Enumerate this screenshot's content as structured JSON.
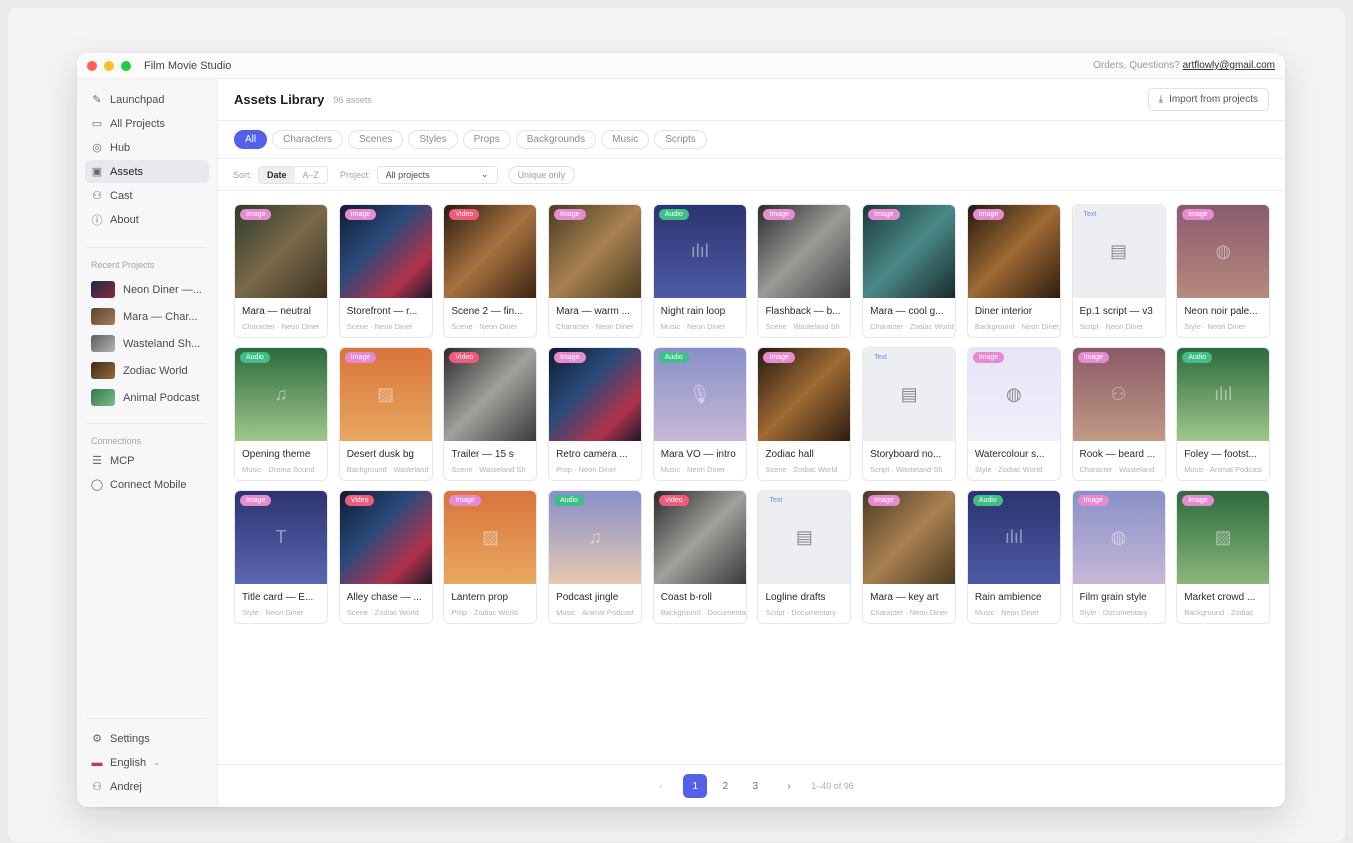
{
  "window": {
    "title": "Film Movie Studio",
    "contact_prefix": "Orders, Questions?",
    "contact_email": "artflowly@gmail.com",
    "traffic_colors": [
      "#ff5f57",
      "#febc2e",
      "#28c840"
    ]
  },
  "sidebar": {
    "nav": [
      {
        "label": "Launchpad",
        "icon": "rocket-icon",
        "glyph": "✎"
      },
      {
        "label": "All Projects",
        "icon": "folder-icon",
        "glyph": "▭"
      },
      {
        "label": "Hub",
        "icon": "compass-icon",
        "glyph": "◎"
      },
      {
        "label": "Assets",
        "icon": "bookmark-icon",
        "glyph": "▣"
      },
      {
        "label": "Cast",
        "icon": "users-icon",
        "glyph": "⚇"
      },
      {
        "label": "About",
        "icon": "info-icon",
        "glyph": "ⓘ"
      }
    ],
    "active_index": 3,
    "recent_label": "Recent Projects",
    "recent": [
      {
        "label": "Neon Diner —...",
        "color": "linear-gradient(135deg,#1c2a48,#8a2a3a)"
      },
      {
        "label": "Mara — Char...",
        "color": "linear-gradient(135deg,#5a4632,#a77c55)"
      },
      {
        "label": "Wasteland Sh...",
        "color": "linear-gradient(135deg,#5c5c5c,#b5b5b0)"
      },
      {
        "label": "Zodiac World",
        "color": "linear-gradient(135deg,#3a2a1c,#9a6a3c)"
      },
      {
        "label": "Animal Podcast",
        "color": "linear-gradient(135deg,#2f7a4a,#7fbb8a)"
      }
    ],
    "connections_label": "Connections",
    "connections": [
      {
        "label": "MCP",
        "icon": "server-icon",
        "glyph": "☰"
      },
      {
        "label": "Connect Mobile",
        "icon": "chat-icon",
        "glyph": "◯"
      }
    ],
    "settings": "Settings",
    "language": "English",
    "user": "Andrej"
  },
  "header": {
    "title": "Assets Library",
    "count": "96 assets",
    "import_label": "Import from projects"
  },
  "tabs": [
    "All",
    "Characters",
    "Scenes",
    "Styles",
    "Props",
    "Backgrounds",
    "Music",
    "Scripts"
  ],
  "filters": {
    "sort_label": "Sort:",
    "sort_options": [
      "Date",
      "A–Z"
    ],
    "project_label": "Project:",
    "project_value": "All projects",
    "unique_label": "Unique only"
  },
  "badge_colors": {
    "Image": "#e58bd0",
    "Video": "#ef5b7b",
    "Audio": "#3fbf87",
    "Text": "#9bb8ef"
  },
  "assets": [
    {
      "title": "Mara — neutral",
      "sub": "Character · Neon Diner",
      "type": "Image",
      "bg": "linear-gradient(135deg,#2e3b2a,#7a6a4a 50%,#3c3020)",
      "glyph": ""
    },
    {
      "title": "Storefront — r...",
      "sub": "Scene · Neon Diner",
      "type": "Image",
      "bg": "linear-gradient(135deg,#0e1a30,#2a4a7a 40%,#b0324a 75%,#1a1a2a)",
      "glyph": ""
    },
    {
      "title": "Scene 2 — fin...",
      "sub": "Scene · Neon Diner",
      "type": "Video",
      "bg": "linear-gradient(135deg,#2a1a10,#a87240 50%,#3a2414)",
      "glyph": ""
    },
    {
      "title": "Mara — warm ...",
      "sub": "Character · Neon Diner",
      "type": "Image",
      "bg": "linear-gradient(135deg,#4a3a24,#a88050 50%,#4a3a20)",
      "glyph": ""
    },
    {
      "title": "Night rain loop",
      "sub": "Music · Neon Diner",
      "type": "Audio",
      "bg": "linear-gradient(180deg,#2c3470,#4d5aa5)",
      "glyph": "ılıl"
    },
    {
      "title": "Flashback — b...",
      "sub": "Scene · Wasteland Sh",
      "type": "Image",
      "bg": "linear-gradient(135deg,#2a2a2a,#9a9a96 50%,#444)",
      "glyph": ""
    },
    {
      "title": "Mara — cool g...",
      "sub": "Character · Zodiac World",
      "type": "Image",
      "bg": "linear-gradient(135deg,#1a3a3a,#4a8a88 50%,#1a2a2a)",
      "glyph": ""
    },
    {
      "title": "Diner interior",
      "sub": "Background · Neon Diner",
      "type": "Image",
      "bg": "linear-gradient(135deg,#241810,#a06a34 50%,#2c1c10)",
      "glyph": ""
    },
    {
      "title": "Ep.1 script — v3",
      "sub": "Script · Neon Diner",
      "type": "Text",
      "bg": "#eceef2",
      "glyph": "▤"
    },
    {
      "title": "Neon noir pale...",
      "sub": "Style · Neon Diner",
      "type": "Image",
      "bg": "linear-gradient(180deg,#8a5a70,#b68a7c)",
      "glyph": "◍"
    },
    {
      "title": "Opening theme",
      "sub": "Music · Drama Sound",
      "type": "Audio",
      "bg": "linear-gradient(180deg,#2e6a3e,#9ec88a)",
      "glyph": "♫"
    },
    {
      "title": "Desert dusk bg",
      "sub": "Background · Wasteland",
      "type": "Image",
      "bg": "linear-gradient(180deg,#d9743c,#e8a860)",
      "glyph": "▨"
    },
    {
      "title": "Trailer — 15 s",
      "sub": "Scene · Wasteland Sh",
      "type": "Video",
      "bg": "linear-gradient(135deg,#2a2a2a,#a0a09c 50%,#3a3a3a)",
      "glyph": ""
    },
    {
      "title": "Retro camera ...",
      "sub": "Prop · Neon Diner",
      "type": "Image",
      "bg": "linear-gradient(135deg,#0e1a30,#2a4a7a 40%,#b0324a 75%,#1a1a2a)",
      "glyph": ""
    },
    {
      "title": "Mara VO — intro",
      "sub": "Music · Neon Diner",
      "type": "Audio",
      "bg": "linear-gradient(180deg,#8890c8,#c8b8d8)",
      "glyph": "🎙"
    },
    {
      "title": "Zodiac hall",
      "sub": "Scene · Zodiac World",
      "type": "Image",
      "bg": "linear-gradient(135deg,#241810,#a06a34 50%,#2c1c10)",
      "glyph": ""
    },
    {
      "title": "Storyboard no...",
      "sub": "Script · Wasteland Sh",
      "type": "Text",
      "bg": "#eceef2",
      "glyph": "▤"
    },
    {
      "title": "Watercolour s...",
      "sub": "Style · Zodiac World",
      "type": "Image",
      "bg": "linear-gradient(180deg,#e8e4f8,#f2eefa)",
      "glyph": "◍"
    },
    {
      "title": "Rook — beard ...",
      "sub": "Character · Wasteland",
      "type": "Image",
      "bg": "linear-gradient(180deg,#8a5a68,#c29a84)",
      "glyph": "⚇"
    },
    {
      "title": "Foley — footst...",
      "sub": "Music · Animal Podcast",
      "type": "Audio",
      "bg": "linear-gradient(180deg,#2e6a3e,#9ec88a)",
      "glyph": "ılıl"
    },
    {
      "title": "Title card — E...",
      "sub": "Style · Neon Diner",
      "type": "Image",
      "bg": "linear-gradient(180deg,#2c3470,#5a66b0)",
      "glyph": "T"
    },
    {
      "title": "Alley chase — ...",
      "sub": "Scene · Zodiac World",
      "type": "Video",
      "bg": "linear-gradient(135deg,#0e1a30,#2a4a7a 40%,#b0324a 75%,#1a1a2a)",
      "glyph": ""
    },
    {
      "title": "Lantern prop",
      "sub": "Prop · Zodiac World",
      "type": "Image",
      "bg": "linear-gradient(180deg,#d9743c,#e8a860)",
      "glyph": "▨"
    },
    {
      "title": "Podcast jingle",
      "sub": "Music · Animal Podcast",
      "type": "Audio",
      "bg": "linear-gradient(180deg,#8890c8,#e8c8b0)",
      "glyph": "♫"
    },
    {
      "title": "Coast b-roll",
      "sub": "Background · Documentary",
      "type": "Video",
      "bg": "linear-gradient(135deg,#2a2a2a,#a0a09c 50%,#3a3a3a)",
      "glyph": ""
    },
    {
      "title": "Logline drafts",
      "sub": "Script · Documentary",
      "type": "Text",
      "bg": "#eceef2",
      "glyph": "▤"
    },
    {
      "title": "Mara — key art",
      "sub": "Character · Neon Diner",
      "type": "Image",
      "bg": "linear-gradient(135deg,#4a3a24,#a88050 50%,#4a3a20)",
      "glyph": ""
    },
    {
      "title": "Rain ambience",
      "sub": "Music · Neon Diner",
      "type": "Audio",
      "bg": "linear-gradient(180deg,#2c3470,#4d5aa5)",
      "glyph": "ılıl"
    },
    {
      "title": "Film grain style",
      "sub": "Style · Documentary",
      "type": "Image",
      "bg": "linear-gradient(180deg,#8890c8,#c8b8d8)",
      "glyph": "◍"
    },
    {
      "title": "Market crowd ...",
      "sub": "Background · Zodiac",
      "type": "Image",
      "bg": "linear-gradient(180deg,#2e6a3e,#8ab87a)",
      "glyph": "▨"
    }
  ],
  "pagination": {
    "pages": [
      "1",
      "2",
      "3"
    ],
    "current": "1",
    "prev": "‹",
    "next": "›",
    "range": "1–40 of 96"
  }
}
